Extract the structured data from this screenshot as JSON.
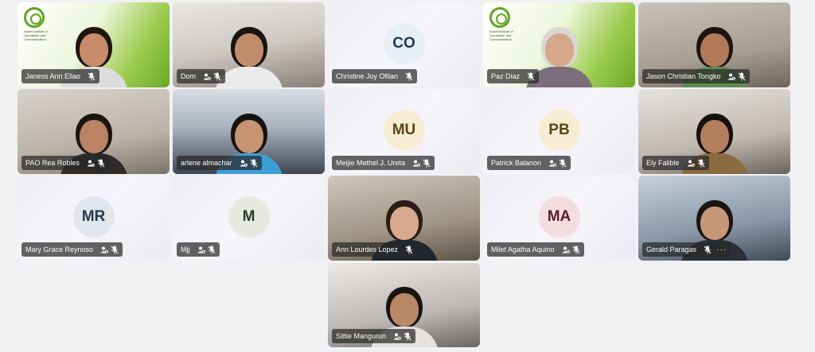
{
  "participants": [
    {
      "name": "Janess Ann Ellao",
      "type": "video",
      "bg": "green",
      "logo_text": "Asian Institute of Journalism and Communication",
      "skin": "#c98c6a",
      "hair": "#1e1611",
      "shirt": "#dcdcdc",
      "host_icon": false
    },
    {
      "name": "Dom",
      "type": "video",
      "bg": "room1",
      "skin": "#c08d6c",
      "hair": "#1a1410",
      "shirt": "#eaeaea",
      "host_icon": true
    },
    {
      "name": "Christine Joy Ofilan",
      "type": "initials",
      "initials": "CO",
      "avatar_bg": "#e7eef4",
      "avatar_fg": "#1f3a56",
      "host_icon": false
    },
    {
      "name": "Paz Diaz",
      "type": "video",
      "bg": "green",
      "logo_text": "Asian Institute of Journalism and Communication",
      "skin": "#d5a88a",
      "hair": "#d9d7d3",
      "shirt": "#7c6e7a",
      "host_icon": false
    },
    {
      "name": "Jason Christian Tongko",
      "type": "video",
      "bg": "room2",
      "skin": "#b27a58",
      "hair": "#1b1612",
      "shirt": "#5d8c52",
      "host_icon": true
    },
    {
      "name": "PAO Rea Robles",
      "type": "video",
      "bg": "room3",
      "skin": "#b98364",
      "hair": "#1b1512",
      "shirt": "#2d2a28",
      "host_icon": true
    },
    {
      "name": "arlene almachar",
      "type": "video",
      "bg": "office",
      "skin": "#c79471",
      "hair": "#171310",
      "shirt": "#3e9fd6",
      "host_icon": true
    },
    {
      "name": "Meijie Methel J. Ureta",
      "type": "initials",
      "initials": "MU",
      "avatar_bg": "#f7edd5",
      "avatar_fg": "#5d4510",
      "host_icon": true
    },
    {
      "name": "Patrick Balanon",
      "type": "initials",
      "initials": "PB",
      "avatar_bg": "#f7edd5",
      "avatar_fg": "#5d4510",
      "host_icon": true
    },
    {
      "name": "Ely Falible",
      "type": "video",
      "bg": "room5",
      "skin": "#b47e5c",
      "hair": "#15110e",
      "shirt": "#8a6a3f",
      "host_icon": true
    },
    {
      "name": "Mary Grace Reynoso",
      "type": "initials",
      "initials": "MR",
      "avatar_bg": "#e1e6ec",
      "avatar_fg": "#26384d",
      "host_icon": true
    },
    {
      "name": "Mjj",
      "type": "initials",
      "initials": "M",
      "avatar_bg": "#e6e9e0",
      "avatar_fg": "#30372a",
      "host_icon": true
    },
    {
      "name": "Ann Lourdes Lopez",
      "type": "video",
      "bg": "room6",
      "skin": "#d8a98c",
      "hair": "#2a1d17",
      "shirt": "#1f2630",
      "host_icon": false
    },
    {
      "name": "Milet Agatha Aquino",
      "type": "initials",
      "initials": "MA",
      "avatar_bg": "#f3dde0",
      "avatar_fg": "#5a1e28",
      "host_icon": true
    },
    {
      "name": "Gerald Paragas",
      "type": "video",
      "bg": "room4",
      "skin": "#c7977a",
      "hair": "#1a1612",
      "shirt": "#2b3036",
      "host_icon": false,
      "more": "···"
    },
    {
      "name": "Sittie Mangurun",
      "type": "video",
      "bg": "room7",
      "skin": "#b98867",
      "hair": "#1b1511",
      "shirt": "#e5e1de",
      "host_icon": true
    }
  ],
  "colors": {
    "nameplate_bg": "rgba(40,40,40,0.72)",
    "page_bg": "#f1f1f3"
  },
  "icons": {
    "host": "people-icon",
    "mic": "mic-muted-icon",
    "more": "more-icon"
  }
}
